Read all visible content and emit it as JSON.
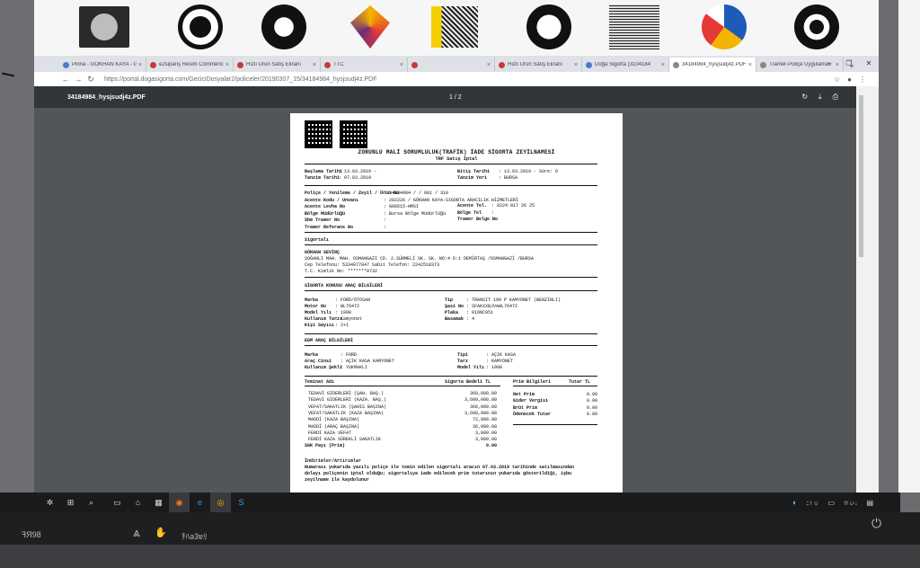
{
  "browser": {
    "tabs": [
      {
        "label": "Pinna - GÖKHAN KAYA - Gi",
        "color": "#4a7bd0",
        "active": false
      },
      {
        "label": "e2sipariş Resim Commenc",
        "color": "#c53b3b",
        "active": false
      },
      {
        "label": "Hızlı Ürün Satış Ekranı",
        "color": "#c53b3b",
        "active": false
      },
      {
        "label": "TTC",
        "color": "#c53b3b",
        "active": false
      },
      {
        "label": "",
        "color": "#c53b3b",
        "active": false
      },
      {
        "label": "Hızlı Ürün Satış Ekranı",
        "color": "#c53b3b",
        "active": false
      },
      {
        "label": "Doğa Sigorta (3104184",
        "color": "#4a7bd0",
        "active": false
      },
      {
        "label": "34184984_hysjsudj4z.PDF",
        "color": "#888888",
        "active": true
      },
      {
        "label": "Tramer-Poliçe Uygulamas",
        "color": "#888888",
        "active": false
      }
    ],
    "url": "https://portal.dogasigorta.com/GeciciDosyalar2/policeler/20190307_15/34184984_hysjsudj4z.PDF"
  },
  "pdf": {
    "filename": "34184984_hysjsudj4z.PDF",
    "page_indicator": "1 / 2"
  },
  "document": {
    "title": "ZORUNLU MALİ SORUMLULUK(TRAFİK) İADE SİGORTA ZEYİLNAMESİ",
    "subtitle": "TRF Satış İptal",
    "header_left": [
      {
        "label": "Başlama Tarihi",
        "value": ": 13.03.2019 -"
      },
      {
        "label": "Tanzim Tarihi",
        "value": ": 07.03.2019"
      }
    ],
    "header_right": [
      {
        "label": "Bitiş Tarihi",
        "value": ": 13.03.2019 -   Süre: 0"
      },
      {
        "label": "Tanzim Yeri",
        "value": ": BURSA"
      }
    ],
    "policy_lines": [
      {
        "label": "Poliçe / Yenileme / Zeyil / Ürün No",
        "value": ": 34184984 /     / 001 / 310"
      },
      {
        "label": "Acente Kodu / Unvanı",
        "value": ": 202226 / GÖKHAN KAYA-SIGORTA ARACILIK HİZMETLERİ"
      },
      {
        "label": "Acente Levha No",
        "value": ": G08515-HMSI"
      },
      {
        "label": "Bölge Müdürlüğü",
        "value": ": Bursa Bölge Müdürlüğü"
      },
      {
        "label": "Sbm Tramer No",
        "value": ":"
      },
      {
        "label": "Tramer Referans No",
        "value": ":"
      }
    ],
    "policy_right": [
      {
        "label": "Acente Tel.",
        "value": ": 0224 817 26 25"
      },
      {
        "label": "Bölge Tel",
        "value": ":"
      },
      {
        "label": "Tramer Belge No",
        "value": ":"
      }
    ],
    "insured_heading": "Sigortalı",
    "insured_lines": [
      "GÖKHAN SEVİNÇ",
      "SOĞANLI MAH. MAH. OSMANGAZİ CD. 2.SÜRMELİ SK. SK.  NO:4 D:1  DEMİRTAŞ /OSMANGAZİ /BURSA",
      "Cep Telefonu: 5334877847  Sabit Telefon: 2242518373",
      "T.C. Kimlik No: *******0732"
    ],
    "vehicle_heading": "SİGORTA KONUSU ARAÇ BİLGİLERİ",
    "vehicle_left": [
      {
        "label": "Marka",
        "value": ": FORD/OTOSAN"
      },
      {
        "label": "Motor No",
        "value": ": WL76472"
      },
      {
        "label": "Model Yılı",
        "value": ": 1998"
      },
      {
        "label": "Kullanım Tarzı",
        "value": ": Kamyonet"
      },
      {
        "label": "Kişi Sayısı",
        "value": ": 2+1"
      }
    ],
    "vehicle_right": [
      {
        "label": "Tip",
        "value": ": TRANSIT 190 P KAMYONET (BENZINLI)"
      },
      {
        "label": "Şasi No",
        "value": ": SFAKXXBJVAWL76472"
      },
      {
        "label": "Plaka",
        "value": ": 016NC951"
      },
      {
        "label": "Basamak",
        "value": ": 4"
      }
    ],
    "egm_heading": "EGM ARAÇ BİLGİLERİ",
    "egm_left": [
      {
        "label": "Marka",
        "value": ": FORD"
      },
      {
        "label": "Araç Cinsi",
        "value": ": AÇIK KASA KAMYONET"
      },
      {
        "label": "Kullanım Şekli",
        "value": ": YUKMAKLI"
      }
    ],
    "egm_right": [
      {
        "label": "Tipi",
        "value": ": AÇIK KASA"
      },
      {
        "label": "Tarz",
        "value": ": KAMYONET"
      },
      {
        "label": "Model Yılı",
        "value": ": 1998"
      }
    ],
    "coverage_header": {
      "name": "Teminat Adı",
      "amount": "Sigorta Bedeli TL"
    },
    "coverage_rows": [
      {
        "name": "TEDAVİ GİDERLERİ (ŞAH. BAŞ.)",
        "amount": "360,000.00"
      },
      {
        "name": "TEDAVİ GİDERLERİ (KAZA. BAŞ.)",
        "amount": "3,600,000.00"
      },
      {
        "name": "VEFAT/SAKATLIK (ŞAHIS BAŞINA)",
        "amount": "360,000.00"
      },
      {
        "name": "VEFAT/SAKATLIK (KAZA BAŞINA)",
        "amount": "3,600,000.00"
      },
      {
        "name": "MADDİ (KAZA BAŞINA)",
        "amount": "72,000.00"
      },
      {
        "name": "MADDİ (ARAÇ BAŞINA)",
        "amount": "36,000.00"
      },
      {
        "name": "FERDİ KAZA VEFAT",
        "amount": "3,000.00"
      },
      {
        "name": "FERDİ KAZA SÜREKLİ SAKATLIK",
        "amount": "3,000.00"
      },
      {
        "name": "SGK Payı (Prim)",
        "amount": "0.00"
      }
    ],
    "premium_header": {
      "name": "Prim Bilgileri",
      "amount": "Tutar TL"
    },
    "premium_rows": [
      {
        "name": "Net Prim",
        "amount": "0.00"
      },
      {
        "name": "Gider Vergisi",
        "amount": "0.00"
      },
      {
        "name": "Brüt Prim",
        "amount": "0.00"
      },
      {
        "name": "Ödenecek Tutar",
        "amount": "0.00"
      }
    ],
    "discount_heading": "İndirimler/Artırımlar",
    "discount_text": [
      "Numarası yukarıda yazılı poliçe ile temin edilen sigortalı aracın 07.03.2019 tarihinde satılmasından",
      "dolayı poliçenin iptal olduğu; sigortalıya iade edilecek prim tutarının yukarıda gösterildiği, işbu",
      "zeyilname ile kaydolunur"
    ]
  },
  "taskbar": {
    "tray_text": "ﾆ ! ☺",
    "clock": "ﾘ! ぃ↓"
  },
  "desk": {
    "left_text": "ꟻЯ98",
    "right_text": "ﾁﾊǝ3ɐﾘ"
  }
}
